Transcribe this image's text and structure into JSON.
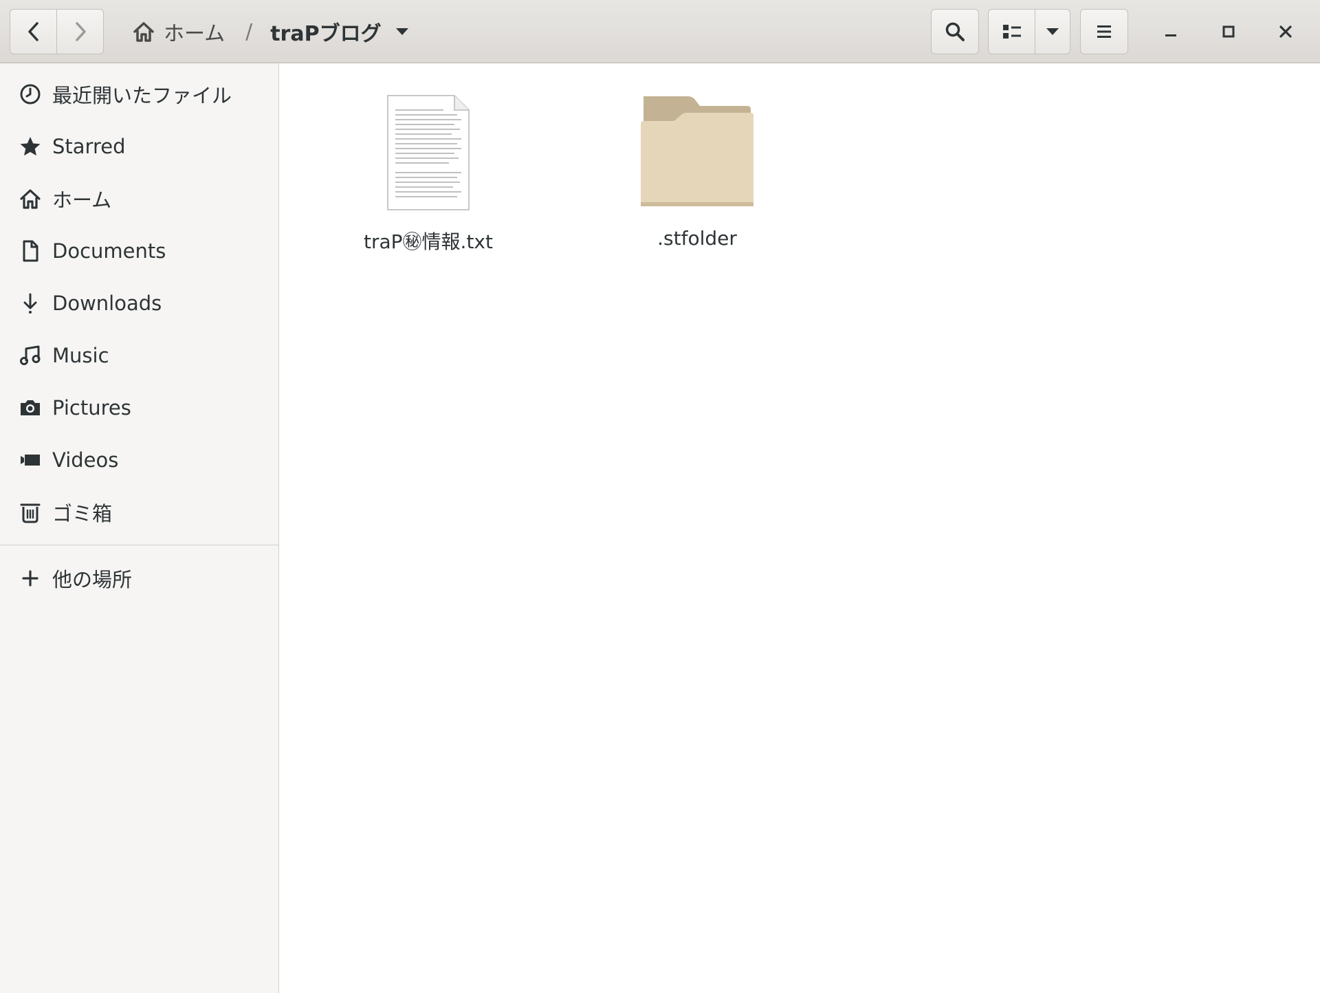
{
  "window": {
    "title": "traPブログ"
  },
  "header": {
    "back_button": "back",
    "forward_button": "forward",
    "breadcrumb": {
      "home_label": "ホーム",
      "separator": "/",
      "current": "traPブログ"
    },
    "icons": {
      "back": "chevron-left-icon",
      "forward": "chevron-right-icon",
      "home": "home-icon",
      "dropdown": "triangle-down-icon",
      "search": "search-icon",
      "view": "list-view-icon",
      "view_options": "triangle-down-icon",
      "menu": "hamburger-icon",
      "minimize": "minimize-icon",
      "maximize": "maximize-icon",
      "close": "close-icon"
    }
  },
  "sidebar": {
    "items": [
      {
        "label": "最近開いたファイル",
        "icon": "clock-icon"
      },
      {
        "label": "Starred",
        "icon": "star-icon"
      },
      {
        "label": "ホーム",
        "icon": "home-icon"
      },
      {
        "label": "Documents",
        "icon": "document-icon"
      },
      {
        "label": "Downloads",
        "icon": "download-icon"
      },
      {
        "label": "Music",
        "icon": "music-icon"
      },
      {
        "label": "Pictures",
        "icon": "camera-icon"
      },
      {
        "label": "Videos",
        "icon": "video-icon"
      },
      {
        "label": "ゴミ箱",
        "icon": "trash-icon"
      }
    ],
    "other_locations": {
      "label": "他の場所",
      "icon": "plus-icon"
    }
  },
  "files": [
    {
      "name": "traP㊙情報.txt",
      "type": "text-file",
      "icon": "text-file-icon"
    },
    {
      "name": ".stfolder",
      "type": "folder",
      "icon": "folder-icon"
    }
  ],
  "colors": {
    "header_bg": "#dcd9d5",
    "sidebar_bg": "#f6f5f4",
    "folder_back": "#c3b394",
    "folder_front": "#e6d6b9",
    "icon_fg": "#2e3436"
  }
}
